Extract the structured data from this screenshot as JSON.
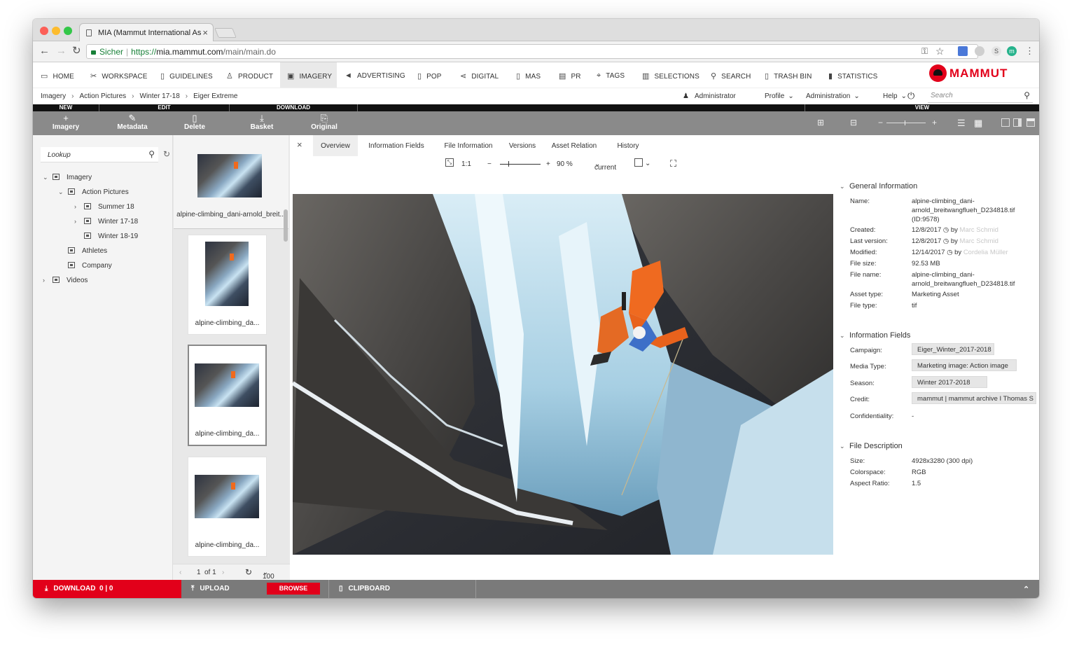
{
  "browser": {
    "tab_title": "MIA (Mammut International As",
    "secure_label": "Sicher",
    "url_protocol": "https://",
    "url_host": "mia.mammut.com",
    "url_path": "/main/main.do"
  },
  "main_nav": [
    {
      "label": "HOME",
      "icon": "home-icon"
    },
    {
      "label": "WORKSPACE",
      "icon": "workspace-icon"
    },
    {
      "label": "GUIDELINES",
      "icon": "book-icon"
    },
    {
      "label": "PRODUCT",
      "icon": "shirt-icon"
    },
    {
      "label": "IMAGERY",
      "icon": "image-icon",
      "active": true
    },
    {
      "label": "ADVERTISING",
      "icon": "megaphone-icon"
    },
    {
      "label": "POP",
      "icon": "bag-icon"
    },
    {
      "label": "DIGITAL",
      "icon": "share-icon"
    },
    {
      "label": "MAS",
      "icon": "mas-icon"
    },
    {
      "label": "PR",
      "icon": "news-icon"
    },
    {
      "label": "TAGS",
      "icon": "tag-icon"
    },
    {
      "label": "SELECTIONS",
      "icon": "selections-icon"
    },
    {
      "label": "SEARCH",
      "icon": "search-icon"
    },
    {
      "label": "TRASH BIN",
      "icon": "trash-icon"
    },
    {
      "label": "STATISTICS",
      "icon": "chart-icon"
    }
  ],
  "brand": {
    "name": "MAMMUT",
    "color": "#e2001a"
  },
  "breadcrumb": [
    "Imagery",
    "Action Pictures",
    "Winter 17-18",
    "Eiger Extreme"
  ],
  "user_menu": {
    "user": "Administrator",
    "profile": "Profile",
    "administration": "Administration",
    "help": "Help",
    "search_placeholder": "Search"
  },
  "category_bar": {
    "new": "NEW",
    "edit": "EDIT",
    "download": "DOWNLOAD",
    "view": "VIEW"
  },
  "toolbar": {
    "imagery": "Imagery",
    "metadata": "Metadata",
    "delete": "Delete",
    "basket": "Basket",
    "original": "Original",
    "zoom_minus": "−",
    "zoom_plus": "+"
  },
  "sidebar": {
    "lookup_placeholder": "Lookup",
    "tree": [
      {
        "label": "Imagery",
        "level": 0,
        "expanded": true
      },
      {
        "label": "Action Pictures",
        "level": 1,
        "expanded": true
      },
      {
        "label": "Summer 18",
        "level": 2,
        "collapsed": true
      },
      {
        "label": "Winter 17-18",
        "level": 2,
        "collapsed": true
      },
      {
        "label": "Winter 18-19",
        "level": 2
      },
      {
        "label": "Athletes",
        "level": 1
      },
      {
        "label": "Company",
        "level": 1
      },
      {
        "label": "Videos",
        "level": 0,
        "collapsed": true
      }
    ]
  },
  "thumbnails": [
    {
      "label": "alpine-climbing_dani-arnold_breit..."
    },
    {
      "label": "alpine-climbing_da..."
    },
    {
      "label": "alpine-climbing_da...",
      "selected": true
    },
    {
      "label": "alpine-climbing_da..."
    }
  ],
  "pager": {
    "page": "1",
    "of_label": "of 1",
    "per_page": "100"
  },
  "viewer_tabs": [
    "Overview",
    "Information Fields",
    "File Information",
    "Versions",
    "Asset Relation",
    "History"
  ],
  "zoom": {
    "one_to_one": "1:1",
    "minus": "−",
    "plus": "+",
    "level": "90 %",
    "version": "current"
  },
  "details": {
    "general_title": "General Information",
    "general": {
      "name_label": "Name:",
      "name_value_1": "alpine-climbing_dani-",
      "name_value_2": "arnold_breitwangflueh_D234818.tif",
      "name_value_3": "(ID:9578)",
      "created_label": "Created:",
      "created_value": "12/8/2017",
      "created_by": "Marc Schmid",
      "last_version_label": "Last version:",
      "last_version_value": "12/8/2017",
      "last_version_by": "Marc Schmid",
      "modified_label": "Modified:",
      "modified_value": "12/14/2017",
      "modified_by": "Cordelia Müller",
      "by_label": "by",
      "file_size_label": "File size:",
      "file_size_value": "92.53 MB",
      "file_name_label": "File name:",
      "file_name_value_1": "alpine-climbing_dani-",
      "file_name_value_2": "arnold_breitwangflueh_D234818.tif",
      "asset_type_label": "Asset type:",
      "asset_type_value": "Marketing Asset",
      "file_type_label": "File type:",
      "file_type_value": "tif"
    },
    "info_title": "Information Fields",
    "info": {
      "campaign_label": "Campaign:",
      "campaign_value": "Eiger_Winter_2017-2018",
      "media_type_label": "Media Type:",
      "media_type_value": "Marketing image: Action image",
      "season_label": "Season:",
      "season_value": "Winter 2017-2018",
      "credit_label": "Credit:",
      "credit_value": "mammut | mammut archive I Thomas S",
      "confidentiality_label": "Confidentiality:",
      "confidentiality_value": "-"
    },
    "file_title": "File Description",
    "file": {
      "size_label": "Size:",
      "size_value": "4928x3280 (300 dpi)",
      "colorspace_label": "Colorspace:",
      "colorspace_value": "RGB",
      "aspect_label": "Aspect Ratio:",
      "aspect_value": "1.5"
    }
  },
  "bottom_bar": {
    "download": "DOWNLOAD",
    "download_count": "0 | 0",
    "upload": "UPLOAD",
    "browse": "BROWSE",
    "clipboard": "CLIPBOARD"
  }
}
